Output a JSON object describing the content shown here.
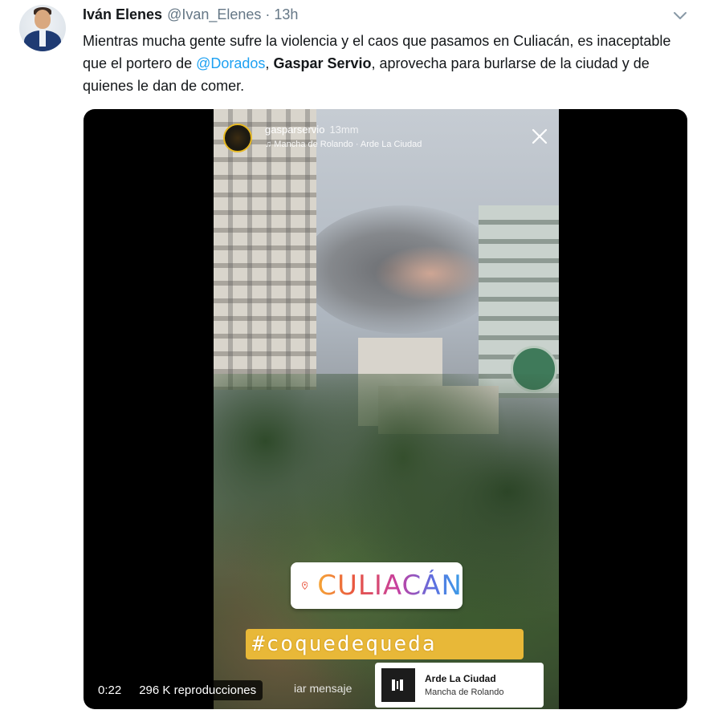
{
  "tweet": {
    "author_name": "Iván Elenes",
    "handle": "@Ivan_Elenes",
    "separator": "·",
    "time": "13h",
    "text_part1": "Mientras mucha gente sufre la violencia y el caos que pasamos en Culiacán, es inaceptable que el portero de ",
    "mention": "@Dorados",
    "text_part2": ", ",
    "bold_name": "Gaspar Servio",
    "text_part3": ", aprovecha para burlarse de la ciudad y de quienes le dan de comer."
  },
  "story": {
    "username": "gasparservio",
    "time": "13mm",
    "music_line": "♫ Mancha de Rolando · Arde La Ciudad",
    "location_sticker": "CULIACÁN",
    "hashtag": "#coquedequeda",
    "send_message": "iar mensaje",
    "music_card": {
      "title": "Arde La Ciudad",
      "artist": "Mancha de Rolando"
    }
  },
  "video": {
    "duration": "0:22",
    "views": "296 K reproducciones"
  },
  "colors": {
    "link": "#1da1f2",
    "muted": "#657786",
    "text": "#14171a",
    "hashtag_bg": "#e8b838"
  },
  "icons": [
    "chevron-down-icon",
    "close-icon",
    "location-pin-icon",
    "music-art-icon"
  ]
}
